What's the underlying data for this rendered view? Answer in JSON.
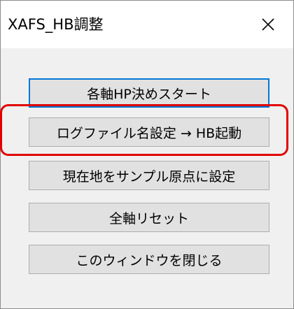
{
  "window": {
    "title": "XAFS_HB調整"
  },
  "colors": {
    "titlebar_bg": "#ffffff",
    "client_bg": "#f0f0f0",
    "button_face": "#e1e1e1",
    "button_border": "#adadad",
    "focus_accent": "#0078d7",
    "highlight_annotation": "#e00000"
  },
  "icons": {
    "close": "close-icon"
  },
  "buttons": [
    {
      "label": "各軸HP決めスタート",
      "focused": true
    },
    {
      "label": "ログファイル名設定 → HB起動",
      "highlighted": true
    },
    {
      "label": "現在地をサンプル原点に設定"
    },
    {
      "label": "全軸リセット"
    },
    {
      "label": "このウィンドウを閉じる"
    }
  ]
}
